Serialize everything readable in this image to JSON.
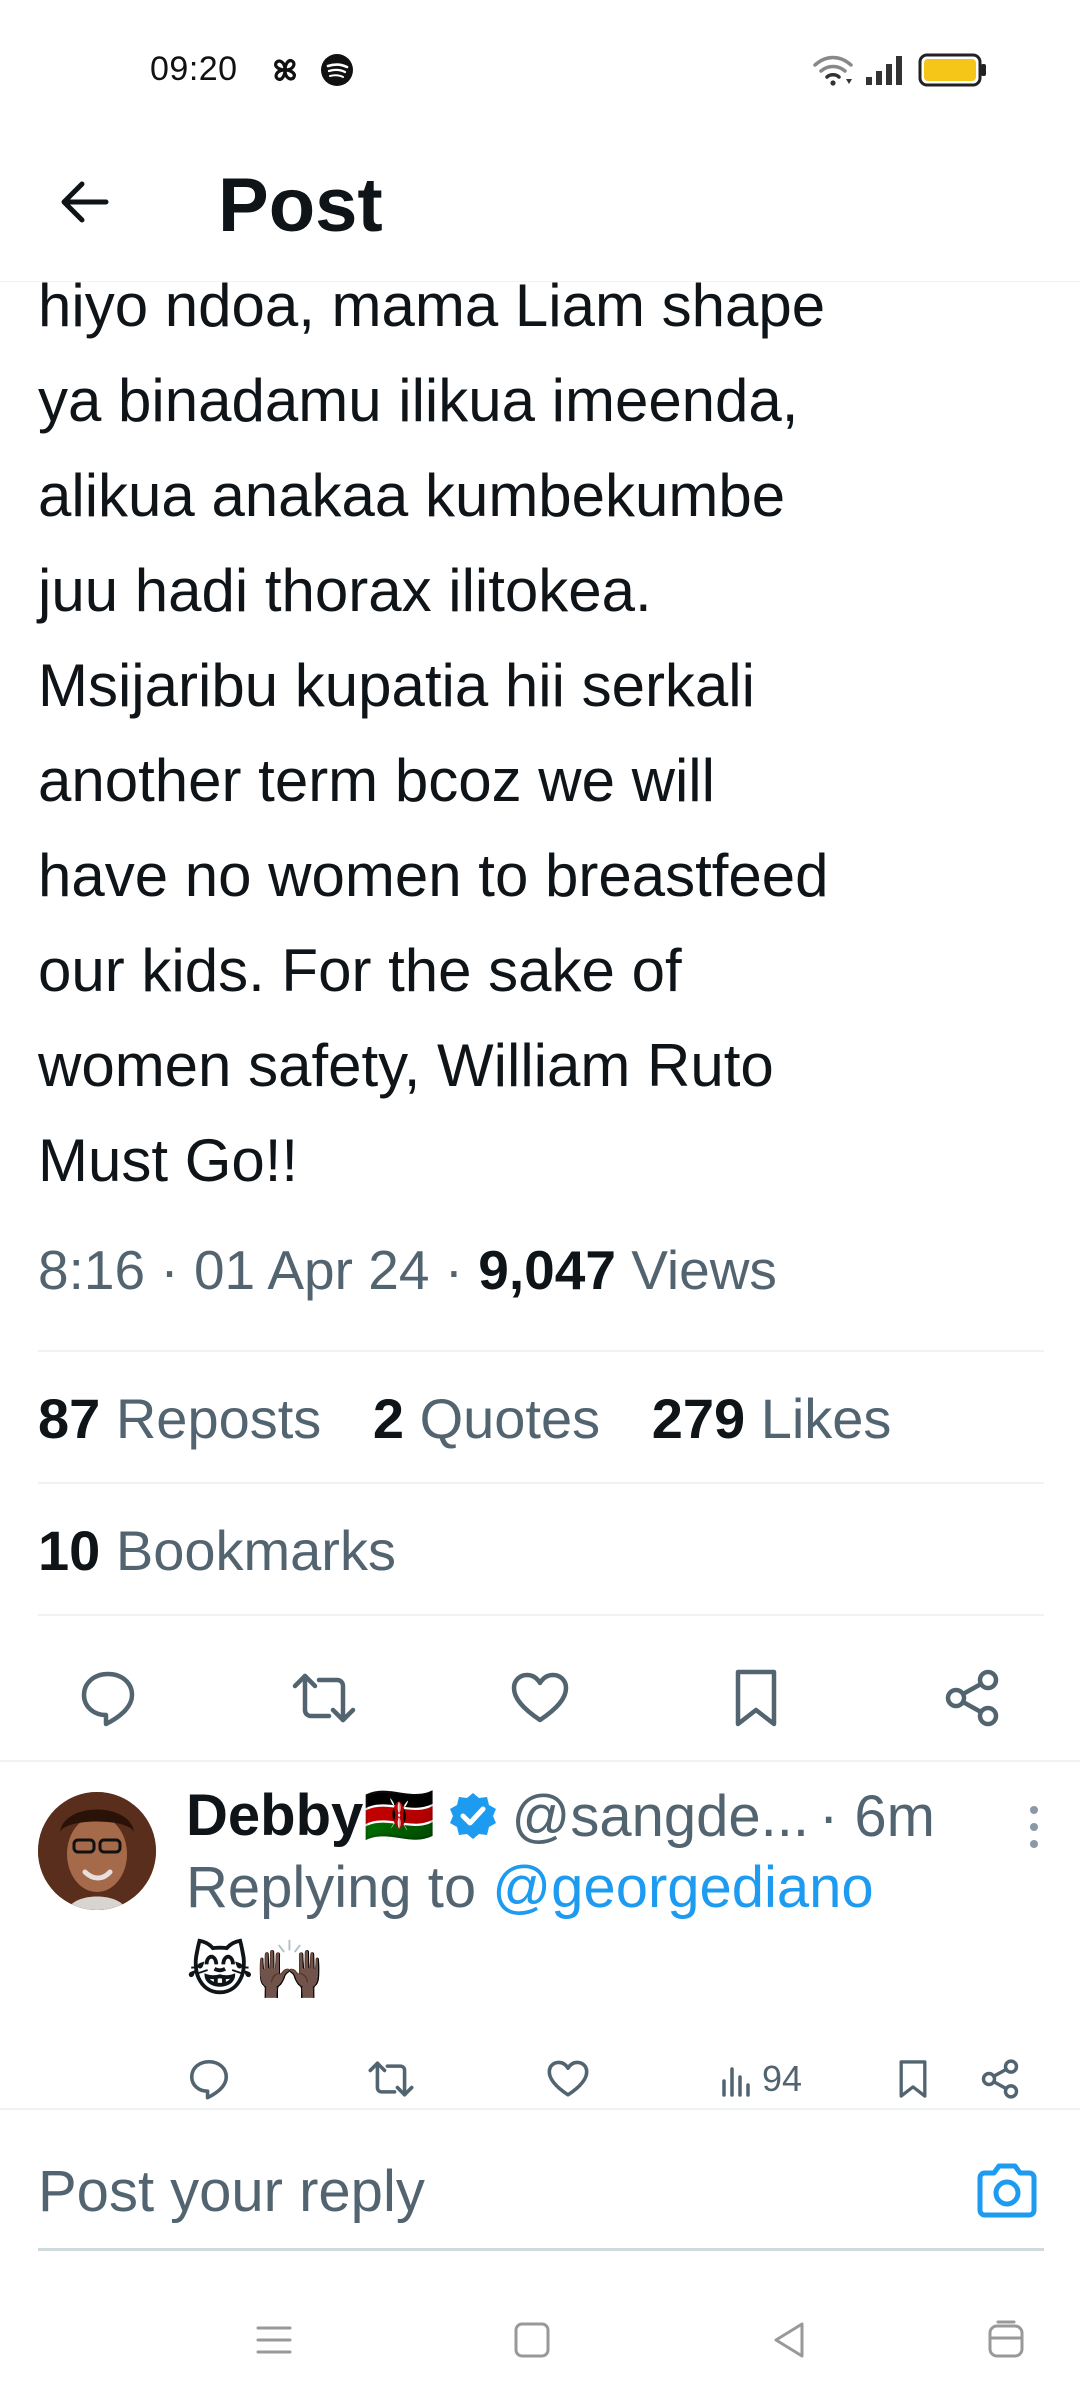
{
  "status_bar": {
    "time": "09:20",
    "left_icons": [
      "pinwheel-icon",
      "spotify-icon"
    ],
    "right_icons": [
      "wifi-icon",
      "signal-icon",
      "battery-icon"
    ],
    "battery_color": "#f5c518"
  },
  "header": {
    "title": "Post"
  },
  "tweet": {
    "text": "hiyo ndoa, mama Liam shape\nya binadamu ilikua imeenda,\nalikua anakaa kumbekumbe\njuu hadi thorax ilitokea.\nMsijaribu kupatia hii serkali\nanother term bcoz we will\nhave no women to breastfeed\nour kids. For the sake of\nwomen safety, William Ruto\nMust Go!!",
    "time": "8:16",
    "date": "01 Apr 24",
    "views_count": "9,047",
    "views_label": "Views",
    "separator": "·"
  },
  "stats": {
    "reposts_count": "87",
    "reposts_label": "Reposts",
    "quotes_count": "2",
    "quotes_label": "Quotes",
    "likes_count": "279",
    "likes_label": "Likes",
    "bookmarks_count": "10",
    "bookmarks_label": "Bookmarks"
  },
  "reply": {
    "name": "Debby🇰🇪",
    "handle": "@sangde...",
    "time": "· 6m",
    "replying_prefix": "Replying to",
    "replying_handle": "@georgediano",
    "content": "😹🙌🏿",
    "views": "94",
    "verified_color": "#1d9bf0"
  },
  "composer": {
    "placeholder": "Post your reply"
  },
  "colors": {
    "accent": "#1d9bf0",
    "text_primary": "#0f1419",
    "text_secondary": "#536471",
    "divider": "#eff3f4"
  }
}
